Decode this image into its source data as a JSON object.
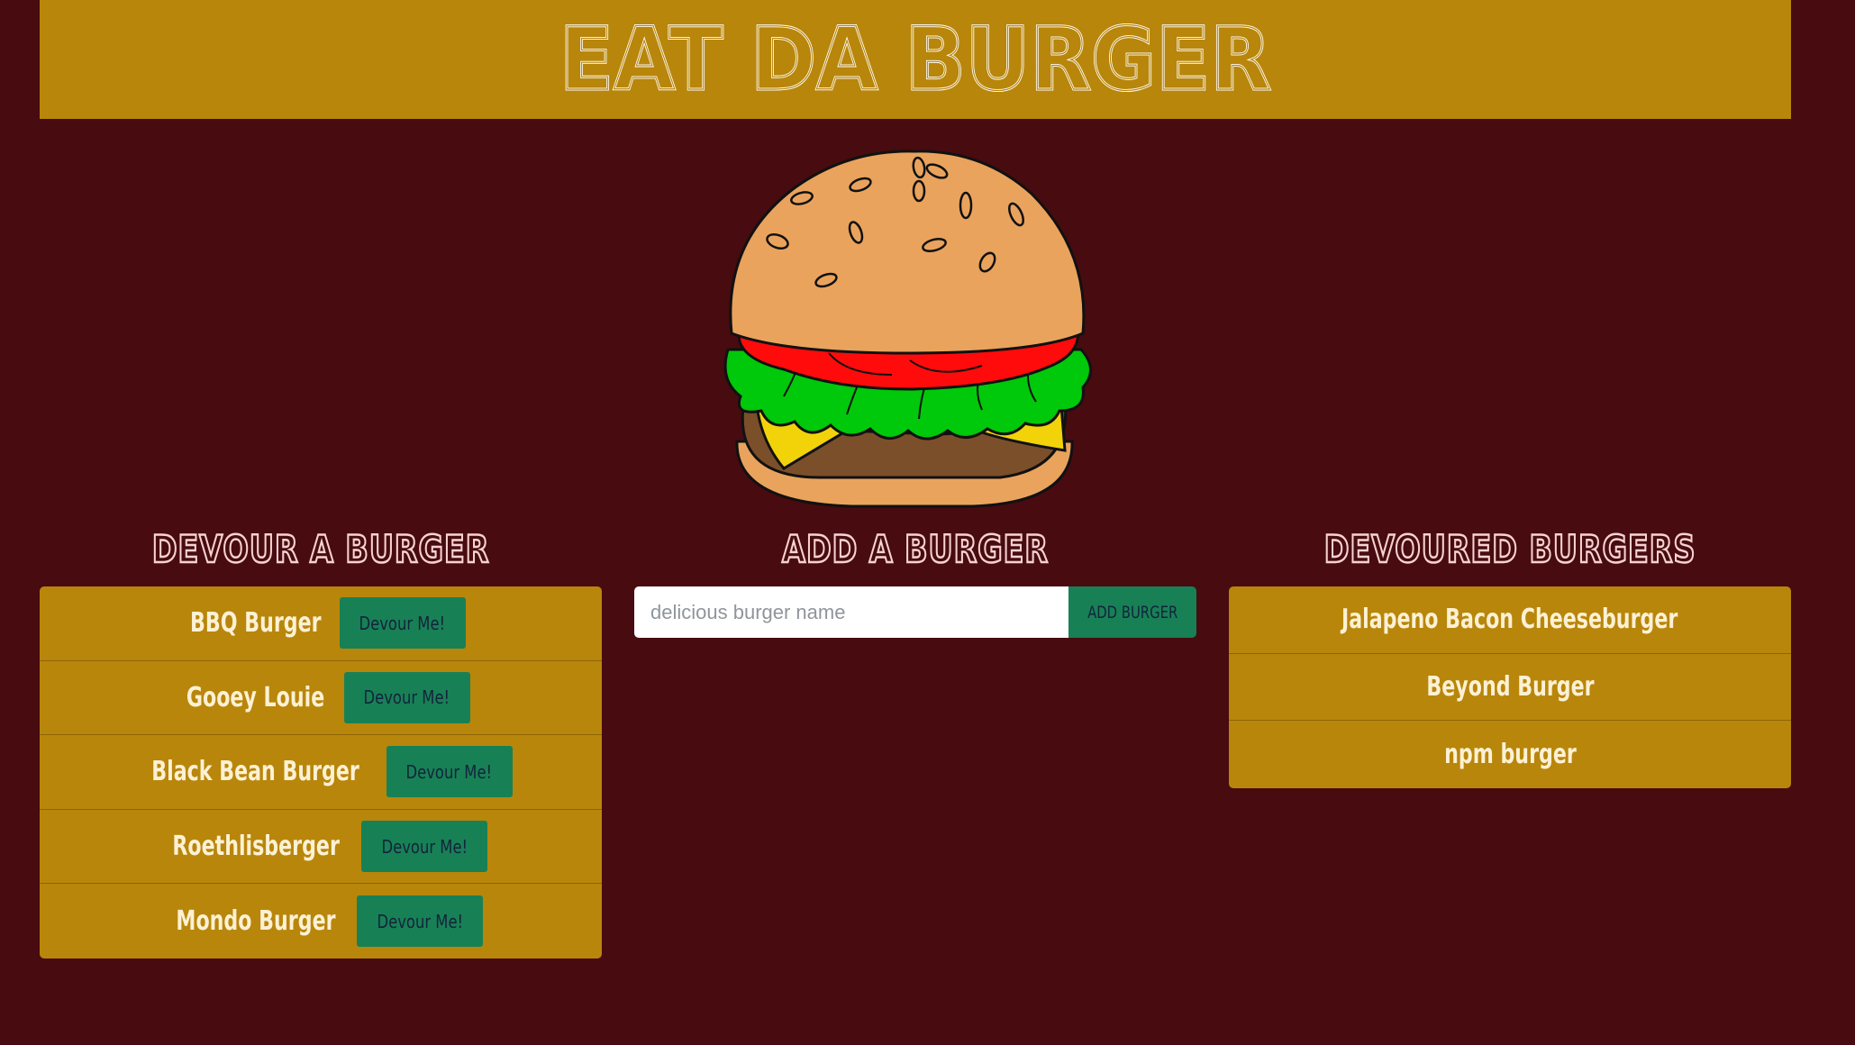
{
  "app": {
    "title": "EAT DA BURGER",
    "colors": {
      "page_background": "#470b10",
      "panel": "#b8860b",
      "button": "#188055",
      "title_outline": "#f7d3cf",
      "item_text": "#fdf1d4"
    }
  },
  "devour": {
    "title": "DEVOUR A BURGER",
    "button_label": "Devour Me!",
    "items": [
      {
        "name": "BBQ Burger"
      },
      {
        "name": "Gooey Louie"
      },
      {
        "name": "Black Bean Burger"
      },
      {
        "name": "Roethlisberger"
      },
      {
        "name": "Mondo Burger"
      }
    ]
  },
  "add": {
    "title": "ADD A BURGER",
    "input_value": "",
    "input_placeholder": "delicious burger name",
    "button_label": "ADD BURGER"
  },
  "devoured": {
    "title": "DEVOURED BURGERS",
    "items": [
      {
        "name": "Jalapeno Bacon Cheeseburger"
      },
      {
        "name": "Beyond Burger"
      },
      {
        "name": "npm burger"
      }
    ]
  },
  "hero": {
    "icon": "hamburger-illustration"
  }
}
